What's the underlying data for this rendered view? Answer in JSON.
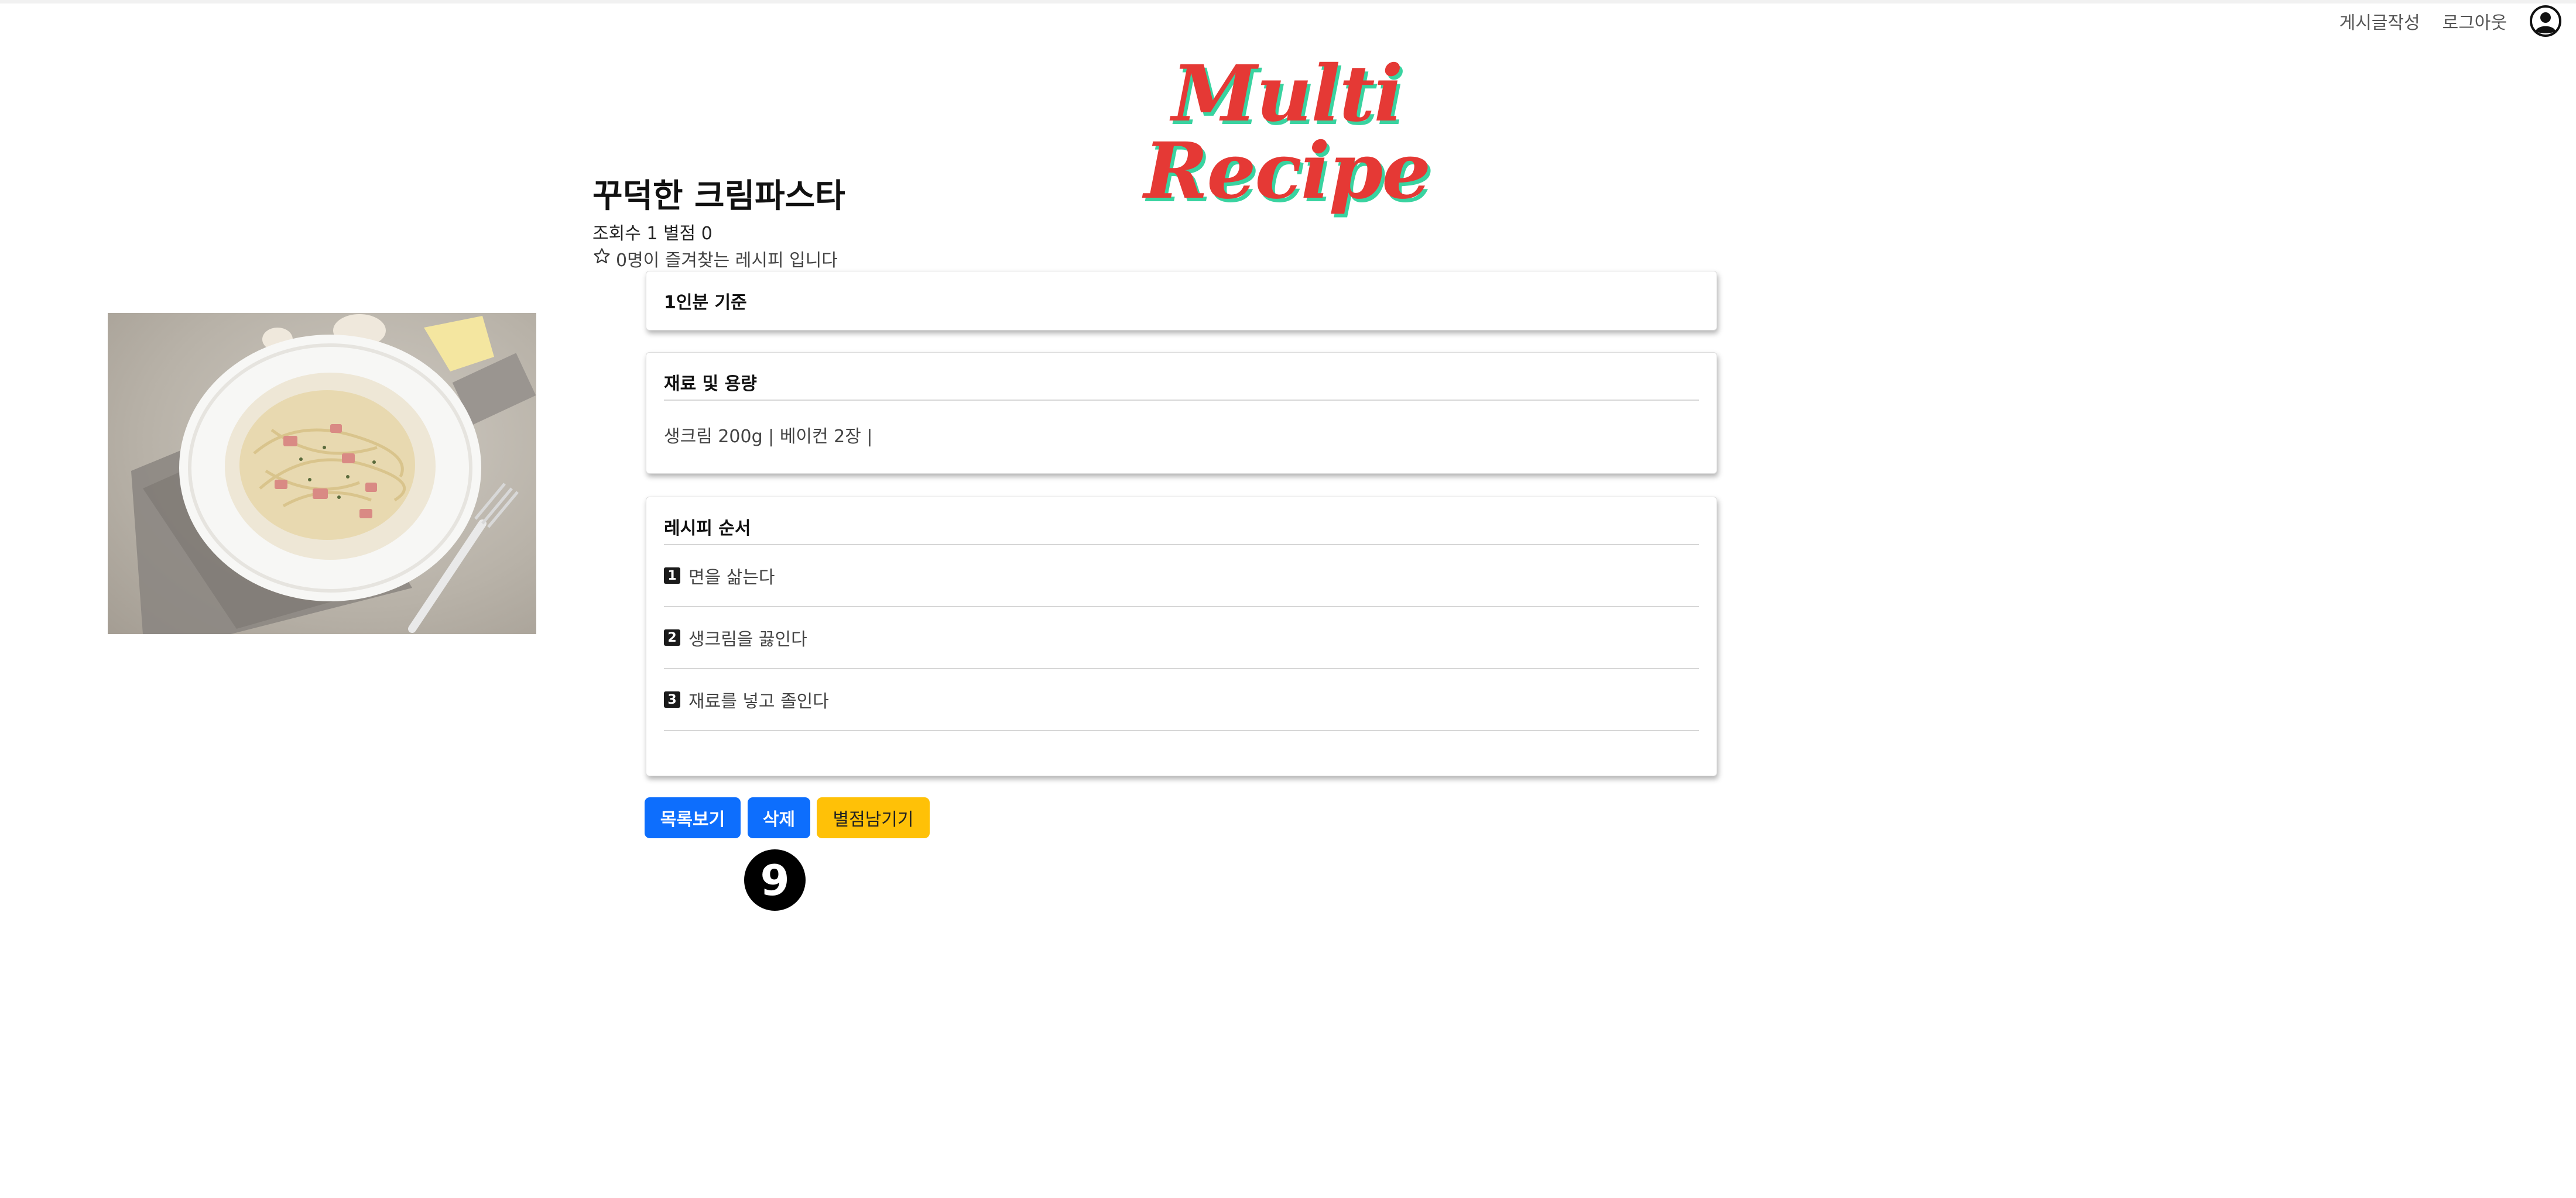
{
  "nav": {
    "write_post": "게시글작성",
    "logout": "로그아웃"
  },
  "logo": {
    "text": "Multi Recipe"
  },
  "recipe": {
    "title": "꾸덕한 크림파스타",
    "stats": "조회수 1 별점 0",
    "favorites": "0명이 즐겨찾는 레시피 입니다"
  },
  "serving": {
    "label": "1인분 기준"
  },
  "ingredients": {
    "title": "재료 및 용량",
    "list": "생크림 200g | 베이컨 2장 |"
  },
  "steps": {
    "title": "레시피 순서",
    "items": [
      {
        "num": "1",
        "text": "면을 삶는다"
      },
      {
        "num": "2",
        "text": "생크림을 끓인다"
      },
      {
        "num": "3",
        "text": "재료를 넣고 졸인다"
      }
    ]
  },
  "buttons": {
    "list": "목록보기",
    "delete": "삭제",
    "rate": "별점남기기"
  },
  "marker": {
    "label": "9"
  },
  "colors": {
    "primary": "#0d6efd",
    "warning": "#ffc107",
    "logo_red": "#e53935",
    "logo_shadow": "#39d3a0"
  }
}
